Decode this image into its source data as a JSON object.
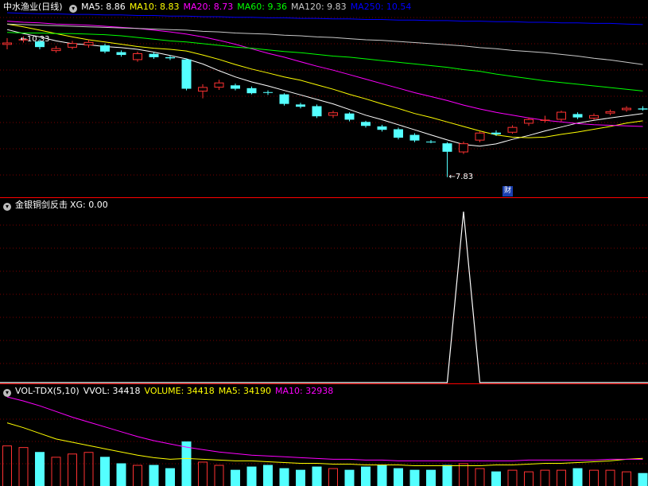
{
  "main_panel": {
    "stock_name": "中水渔业",
    "period": "(日线)",
    "indicators": [
      {
        "label": "MA5: 8.86",
        "color": "#ffffff"
      },
      {
        "label": "MA10: 8.83",
        "color": "#ffff00"
      },
      {
        "label": "MA20: 8.73",
        "color": "#ff00ff"
      },
      {
        "label": "MA60: 9.36",
        "color": "#00ff00"
      },
      {
        "label": "MA120: 9.83",
        "color": "#c8c8c8"
      },
      {
        "label": "MA250: 10.54",
        "color": "#0000ff"
      }
    ],
    "high_label": "10.33",
    "low_label": "7.83",
    "finance_badge": "财"
  },
  "signal_panel": {
    "name": "金银铜剑反击",
    "value_label": "XG: 0.00"
  },
  "volume_panel": {
    "name": "VOL-TDX(5,10)",
    "indicators": [
      {
        "label": "VVOL: 34418",
        "color": "#ffffff"
      },
      {
        "label": "VOLUME: 34418",
        "color": "#ffff00"
      },
      {
        "label": "MA5: 34190",
        "color": "#ffff00"
      },
      {
        "label": "MA10: 32938",
        "color": "#ff00ff"
      }
    ]
  },
  "colors": {
    "up": "#ff3232",
    "down": "#54ffff",
    "grid": "#7a0000",
    "divider": "#ff0000"
  },
  "chart_data": {
    "type": "candlestick",
    "price_range": [
      7.5,
      10.75
    ],
    "candles": [
      {
        "o": 10.18,
        "c": 10.22,
        "h": 10.3,
        "l": 10.1
      },
      {
        "o": 10.26,
        "c": 10.28,
        "h": 10.33,
        "l": 10.22
      },
      {
        "o": 10.24,
        "c": 10.14,
        "h": 10.28,
        "l": 10.1
      },
      {
        "o": 10.07,
        "c": 10.12,
        "h": 10.16,
        "l": 10.04
      },
      {
        "o": 10.13,
        "c": 10.21,
        "h": 10.25,
        "l": 10.1
      },
      {
        "o": 10.17,
        "c": 10.23,
        "h": 10.27,
        "l": 10.13
      },
      {
        "o": 10.17,
        "c": 10.06,
        "h": 10.2,
        "l": 10.03
      },
      {
        "o": 10.05,
        "c": 10.0,
        "h": 10.08,
        "l": 9.97
      },
      {
        "o": 9.91,
        "c": 10.03,
        "h": 10.06,
        "l": 9.88
      },
      {
        "o": 10.02,
        "c": 9.96,
        "h": 10.05,
        "l": 9.93
      },
      {
        "o": 9.96,
        "c": 9.94,
        "h": 9.99,
        "l": 9.91
      },
      {
        "o": 9.92,
        "c": 9.4,
        "h": 9.94,
        "l": 9.37
      },
      {
        "o": 9.35,
        "c": 9.43,
        "h": 9.48,
        "l": 9.23
      },
      {
        "o": 9.42,
        "c": 9.51,
        "h": 9.56,
        "l": 9.38
      },
      {
        "o": 9.46,
        "c": 9.4,
        "h": 9.49,
        "l": 9.37
      },
      {
        "o": 9.41,
        "c": 9.32,
        "h": 9.44,
        "l": 9.3
      },
      {
        "o": 9.34,
        "c": 9.33,
        "h": 9.37,
        "l": 9.29
      },
      {
        "o": 9.3,
        "c": 9.13,
        "h": 9.32,
        "l": 9.1
      },
      {
        "o": 9.12,
        "c": 9.08,
        "h": 9.15,
        "l": 9.05
      },
      {
        "o": 9.09,
        "c": 8.91,
        "h": 9.12,
        "l": 8.88
      },
      {
        "o": 8.92,
        "c": 8.98,
        "h": 9.01,
        "l": 8.88
      },
      {
        "o": 8.96,
        "c": 8.85,
        "h": 8.98,
        "l": 8.82
      },
      {
        "o": 8.81,
        "c": 8.74,
        "h": 8.83,
        "l": 8.71
      },
      {
        "o": 8.73,
        "c": 8.67,
        "h": 8.76,
        "l": 8.64
      },
      {
        "o": 8.68,
        "c": 8.53,
        "h": 8.71,
        "l": 8.5
      },
      {
        "o": 8.58,
        "c": 8.48,
        "h": 8.61,
        "l": 8.45
      },
      {
        "o": 8.46,
        "c": 8.45,
        "h": 8.49,
        "l": 8.43
      },
      {
        "o": 8.43,
        "c": 8.28,
        "h": 8.45,
        "l": 7.83
      },
      {
        "o": 8.27,
        "c": 8.43,
        "h": 8.46,
        "l": 8.24
      },
      {
        "o": 8.48,
        "c": 8.62,
        "h": 8.64,
        "l": 8.45
      },
      {
        "o": 8.62,
        "c": 8.59,
        "h": 8.66,
        "l": 8.56
      },
      {
        "o": 8.62,
        "c": 8.72,
        "h": 8.75,
        "l": 8.6
      },
      {
        "o": 8.78,
        "c": 8.86,
        "h": 8.89,
        "l": 8.74
      },
      {
        "o": 8.85,
        "c": 8.85,
        "h": 8.92,
        "l": 8.8
      },
      {
        "o": 8.85,
        "c": 8.99,
        "h": 9.01,
        "l": 8.82
      },
      {
        "o": 8.95,
        "c": 8.89,
        "h": 8.98,
        "l": 8.86
      },
      {
        "o": 8.87,
        "c": 8.93,
        "h": 8.96,
        "l": 8.85
      },
      {
        "o": 8.96,
        "c": 9.0,
        "h": 9.03,
        "l": 8.93
      },
      {
        "o": 9.02,
        "c": 9.06,
        "h": 9.09,
        "l": 8.99
      },
      {
        "o": 9.05,
        "c": 9.03,
        "h": 9.09,
        "l": 9.01
      }
    ],
    "ma_lines": [
      {
        "name": "MA5",
        "color": "#ffffff",
        "values": [
          10.45,
          10.38,
          10.32,
          10.25,
          10.2,
          10.18,
          10.15,
          10.13,
          10.1,
          10.05,
          9.99,
          9.93,
          9.84,
          9.72,
          9.61,
          9.52,
          9.45,
          9.37,
          9.29,
          9.21,
          9.13,
          9.03,
          8.93,
          8.85,
          8.76,
          8.67,
          8.58,
          8.49,
          8.41,
          8.38,
          8.42,
          8.5,
          8.57,
          8.65,
          8.72,
          8.79,
          8.84,
          8.88,
          8.92,
          8.96
        ]
      },
      {
        "name": "MA10",
        "color": "#ffff00",
        "values": [
          10.55,
          10.5,
          10.44,
          10.38,
          10.32,
          10.27,
          10.23,
          10.19,
          10.15,
          10.12,
          10.1,
          10.07,
          10.0,
          9.92,
          9.83,
          9.75,
          9.68,
          9.61,
          9.55,
          9.47,
          9.39,
          9.3,
          9.22,
          9.13,
          9.05,
          8.96,
          8.89,
          8.81,
          8.73,
          8.65,
          8.58,
          8.54,
          8.53,
          8.54,
          8.59,
          8.63,
          8.68,
          8.73,
          8.79,
          8.83
        ]
      },
      {
        "name": "MA20",
        "color": "#ff00ff",
        "values": [
          10.6,
          10.58,
          10.57,
          10.55,
          10.54,
          10.53,
          10.51,
          10.49,
          10.47,
          10.44,
          10.41,
          10.37,
          10.32,
          10.26,
          10.19,
          10.11,
          10.03,
          9.96,
          9.88,
          9.8,
          9.73,
          9.65,
          9.57,
          9.49,
          9.41,
          9.33,
          9.26,
          9.19,
          9.11,
          9.04,
          8.98,
          8.93,
          8.88,
          8.84,
          8.81,
          8.78,
          8.76,
          8.75,
          8.74,
          8.73
        ]
      },
      {
        "name": "MA60",
        "color": "#00ff00",
        "values": [
          10.4,
          10.39,
          10.39,
          10.38,
          10.38,
          10.37,
          10.36,
          10.34,
          10.31,
          10.28,
          10.25,
          10.23,
          10.2,
          10.17,
          10.14,
          10.12,
          10.09,
          10.06,
          10.04,
          10.01,
          9.98,
          9.96,
          9.93,
          9.9,
          9.87,
          9.84,
          9.81,
          9.78,
          9.74,
          9.71,
          9.66,
          9.62,
          9.58,
          9.54,
          9.51,
          9.48,
          9.45,
          9.42,
          9.39,
          9.36
        ]
      },
      {
        "name": "MA120",
        "color": "#c8c8c8",
        "values": [
          10.55,
          10.54,
          10.53,
          10.52,
          10.51,
          10.5,
          10.49,
          10.48,
          10.47,
          10.46,
          10.45,
          10.44,
          10.42,
          10.41,
          10.39,
          10.38,
          10.37,
          10.35,
          10.34,
          10.32,
          10.31,
          10.29,
          10.27,
          10.26,
          10.24,
          10.22,
          10.2,
          10.18,
          10.16,
          10.13,
          10.11,
          10.08,
          10.06,
          10.04,
          10.01,
          9.98,
          9.94,
          9.91,
          9.87,
          9.83
        ]
      },
      {
        "name": "MA250",
        "color": "#0000ff",
        "values": [
          10.75,
          10.74,
          10.73,
          10.73,
          10.72,
          10.72,
          10.71,
          10.71,
          10.7,
          10.7,
          10.69,
          10.69,
          10.68,
          10.68,
          10.67,
          10.67,
          10.66,
          10.66,
          10.65,
          10.65,
          10.64,
          10.64,
          10.63,
          10.63,
          10.62,
          10.62,
          10.61,
          10.61,
          10.6,
          10.6,
          10.59,
          10.59,
          10.58,
          10.58,
          10.57,
          10.57,
          10.56,
          10.56,
          10.55,
          10.54
        ]
      }
    ],
    "xg_signal": {
      "range": [
        0,
        1
      ],
      "values": [
        0,
        0,
        0,
        0,
        0,
        0,
        0,
        0,
        0,
        0,
        0,
        0,
        0,
        0,
        0,
        0,
        0,
        0,
        0,
        0,
        0,
        0,
        0,
        0,
        0,
        0,
        0,
        0,
        1,
        0,
        0,
        0,
        0,
        0,
        0,
        0,
        0,
        0,
        0,
        0
      ]
    },
    "volume": {
      "max": 110000,
      "values": [
        50000,
        48000,
        42000,
        36000,
        40000,
        42000,
        36000,
        28000,
        26000,
        26000,
        22000,
        55000,
        30000,
        26000,
        20000,
        24000,
        26000,
        22000,
        20000,
        24000,
        22000,
        20000,
        24000,
        26000,
        22000,
        20000,
        20000,
        26000,
        28000,
        22000,
        18000,
        20000,
        18000,
        20000,
        20000,
        22000,
        20000,
        20000,
        18000,
        16000
      ],
      "ma5": [
        78000,
        72000,
        65000,
        58000,
        54000,
        50000,
        46000,
        42000,
        38000,
        35000,
        33000,
        34000,
        33000,
        32000,
        31000,
        31000,
        30000,
        29000,
        28000,
        28000,
        27000,
        27000,
        26000,
        26000,
        26000,
        25000,
        25000,
        25000,
        25000,
        25000,
        26000,
        26000,
        27000,
        28000,
        28000,
        29000,
        30000,
        31000,
        33000,
        34190
      ],
      "ma10": [
        110000,
        105000,
        99000,
        92000,
        85000,
        79000,
        73000,
        67000,
        61000,
        56000,
        52000,
        48000,
        45000,
        42000,
        40000,
        38000,
        37000,
        36000,
        35000,
        34000,
        33000,
        33000,
        32000,
        32000,
        31000,
        31000,
        31000,
        31000,
        31000,
        31000,
        31000,
        31000,
        32000,
        32000,
        32000,
        32000,
        32000,
        33000,
        33000,
        32938
      ]
    }
  }
}
